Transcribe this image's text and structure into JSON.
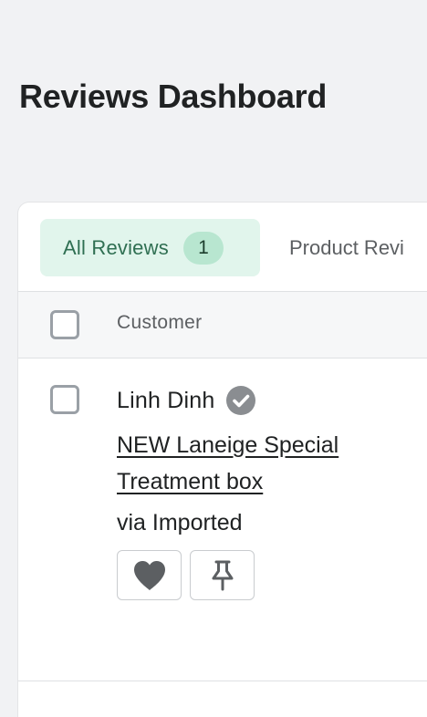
{
  "page": {
    "title": "Reviews Dashboard"
  },
  "tabs": [
    {
      "label": "All Reviews",
      "count": "1",
      "active": true
    },
    {
      "label": "Product Revi",
      "active": false
    }
  ],
  "table": {
    "columns": [
      "Customer"
    ],
    "rows": [
      {
        "customer_name": "Linh Dinh",
        "verified": true,
        "product": "NEW Laneige Special Treatment box",
        "source": "via Imported",
        "actions": [
          "heart-icon",
          "pin-icon"
        ]
      }
    ]
  },
  "colors": {
    "active_tab_bg": "#e1f5ec",
    "active_tab_text": "#2f6f52",
    "count_badge_bg": "#b8e6d0",
    "verified_badge": "#8a8d91",
    "icon_fill": "#5c5f62"
  }
}
